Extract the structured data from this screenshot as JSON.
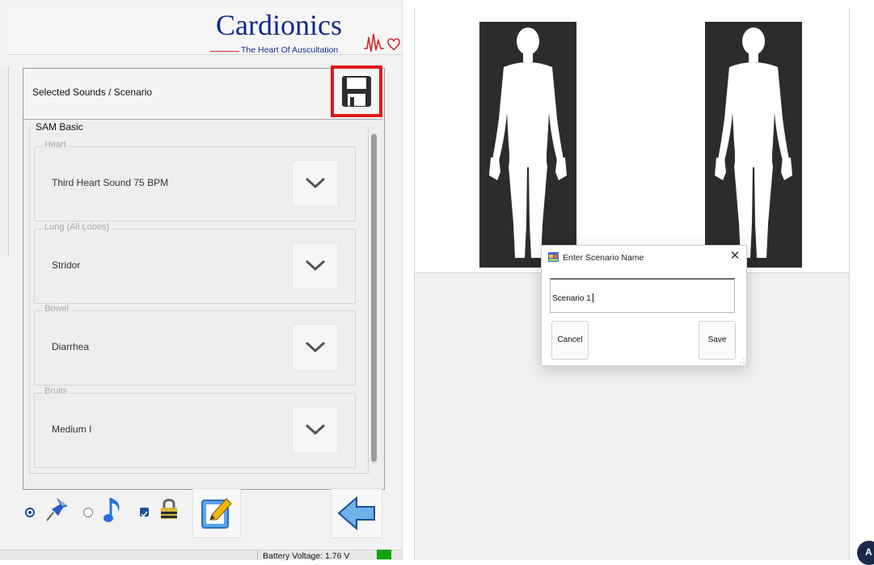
{
  "app": {
    "logo_text": "Cardionics",
    "logo_tagline": "The Heart Of Auscultation",
    "brand_color": "#0e2b8c"
  },
  "panel": {
    "selected_label": "Selected Sounds / Scenario",
    "save_icon": "floppy-disk-icon",
    "highlight_color": "#e01818"
  },
  "scenario": {
    "name": "SAM Basic",
    "groups": [
      {
        "title": "Heart",
        "value": "Third Heart Sound 75 BPM"
      },
      {
        "title": "Lung (All Lobes)",
        "value": "Stridor"
      },
      {
        "title": "Bowel",
        "value": "Diarrhea"
      },
      {
        "title": "Bruits",
        "value": "Medium I"
      }
    ]
  },
  "toolbar": {
    "pin_icon": "pushpin-icon",
    "note_icon": "music-note-icon",
    "lock_icon": "padlock-icon",
    "edit_icon": "edit-icon",
    "back_icon": "back-arrow-icon"
  },
  "status": {
    "battery_text": "Battery Voltage: 1.76 V",
    "battery_color": "#11a211"
  },
  "dialog": {
    "title": "Enter Scenario Name",
    "input_value": "Scenario 1",
    "cancel_label": "Cancel",
    "save_label": "Save",
    "close_glyph": "✕"
  },
  "badge": {
    "label": "A"
  }
}
